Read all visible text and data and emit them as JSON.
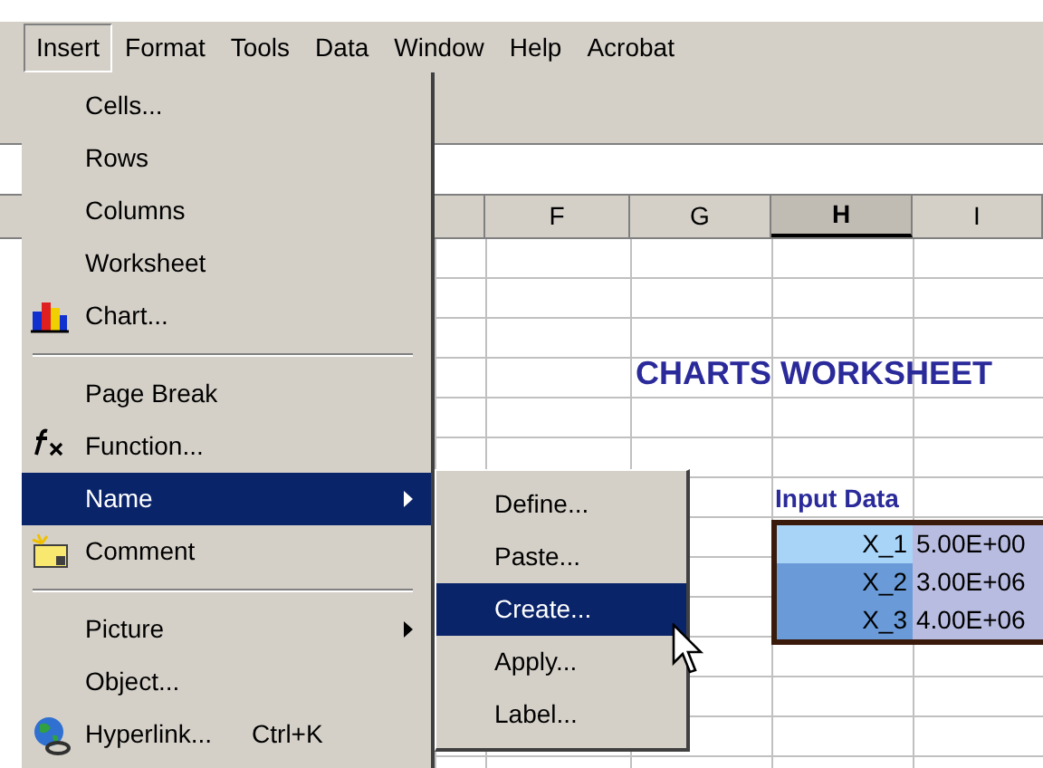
{
  "menu_bar": [
    {
      "label": "Insert",
      "selected": true
    },
    {
      "label": "Format",
      "selected": false
    },
    {
      "label": "Tools",
      "selected": false
    },
    {
      "label": "Data",
      "selected": false
    },
    {
      "label": "Window",
      "selected": false
    },
    {
      "label": "Help",
      "selected": false
    },
    {
      "label": "Acrobat",
      "selected": false
    }
  ],
  "insert_menu": [
    {
      "kind": "item",
      "label": "Cells...",
      "selected": false
    },
    {
      "kind": "item",
      "label": "Rows",
      "selected": false
    },
    {
      "kind": "item",
      "label": "Columns",
      "selected": false
    },
    {
      "kind": "item",
      "label": "Worksheet",
      "selected": false
    },
    {
      "kind": "item",
      "label": "Chart...",
      "selected": false
    },
    {
      "kind": "separator"
    },
    {
      "kind": "item",
      "label": "Page Break",
      "selected": false
    },
    {
      "kind": "item",
      "label": "Function...",
      "selected": false
    },
    {
      "kind": "item",
      "label": "Name",
      "selected": true,
      "submenu": true
    },
    {
      "kind": "item",
      "label": "Comment",
      "selected": false
    },
    {
      "kind": "separator"
    },
    {
      "kind": "item",
      "label": "Picture",
      "selected": false,
      "submenu": true
    },
    {
      "kind": "item",
      "label": "Object...",
      "selected": false
    },
    {
      "kind": "item",
      "label": "Hyperlink...",
      "selected": false,
      "shortcut": "Ctrl+K"
    }
  ],
  "name_submenu": [
    {
      "label": "Define...",
      "selected": false
    },
    {
      "label": "Paste...",
      "selected": false
    },
    {
      "label": "Create...",
      "selected": true
    },
    {
      "label": "Apply...",
      "selected": false
    },
    {
      "label": "Label...",
      "selected": false
    }
  ],
  "sheet": {
    "columns": [
      {
        "label": "F",
        "selected": false
      },
      {
        "label": "G",
        "selected": false
      },
      {
        "label": "H",
        "selected": true
      },
      {
        "label": "I",
        "selected": false
      }
    ],
    "title": "CHARTS WORKSHEET",
    "input_label": "Input Data",
    "input_rows": [
      {
        "name": "X_1",
        "value": "5.00E+00",
        "active": true
      },
      {
        "name": "X_2",
        "value": "3.00E+06",
        "active": false
      },
      {
        "name": "X_3",
        "value": "4.00E+06",
        "active": false
      }
    ]
  }
}
